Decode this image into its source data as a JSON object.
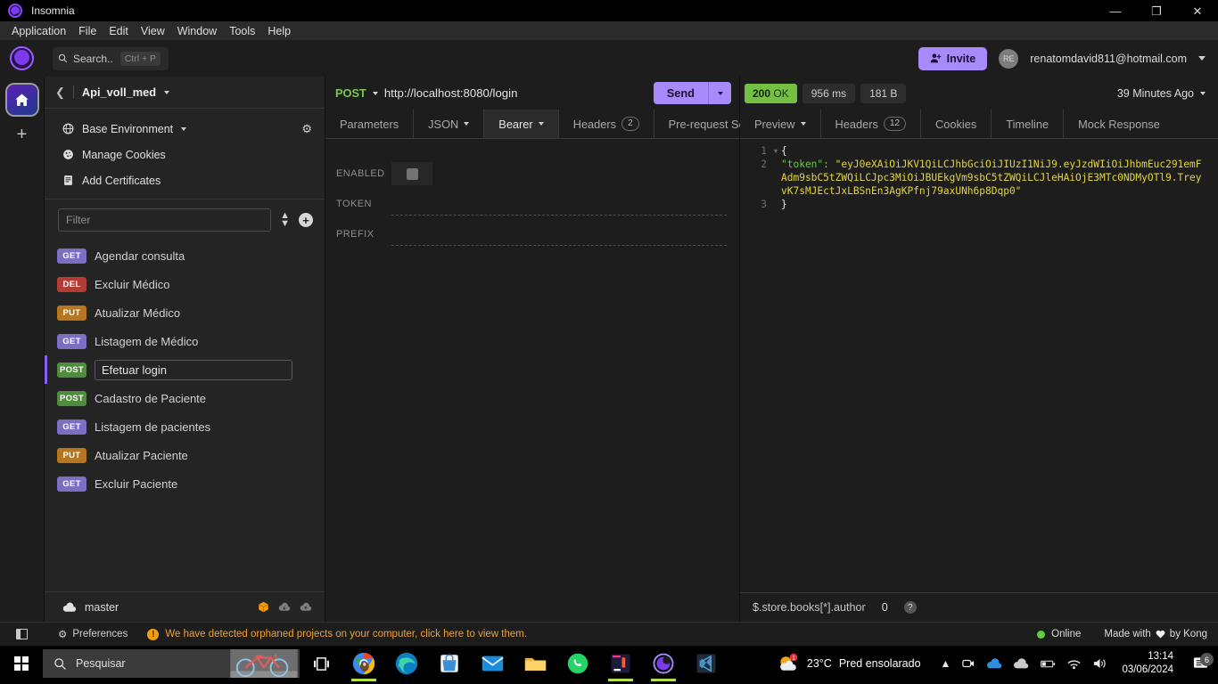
{
  "window": {
    "app_title": "Insomnia",
    "minimize": "—",
    "maximize": "❐",
    "close": "✕"
  },
  "menubar": {
    "items": [
      "Application",
      "File",
      "Edit",
      "View",
      "Window",
      "Tools",
      "Help"
    ]
  },
  "header": {
    "search_placeholder": "Search..",
    "search_shortcut": "Ctrl + P",
    "invite_label": "Invite",
    "avatar_initials": "RE",
    "account_email": "renatomdavid811@hotmail.com"
  },
  "sidebar": {
    "workspace": "Api_voll_med",
    "environment": {
      "label": "Base Environment",
      "cookies": "Manage Cookies",
      "certificates": "Add Certificates"
    },
    "filter_placeholder": "Filter",
    "requests": [
      {
        "method": "GET",
        "name": "Agendar consulta",
        "active": false
      },
      {
        "method": "DEL",
        "name": "Excluir Médico",
        "active": false
      },
      {
        "method": "PUT",
        "name": "Atualizar Médico",
        "active": false
      },
      {
        "method": "GET",
        "name": "Listagem de Médico",
        "active": false
      },
      {
        "method": "POST",
        "name": "Efetuar login",
        "active": true
      },
      {
        "method": "POST",
        "name": "Cadastro de Paciente",
        "active": false
      },
      {
        "method": "GET",
        "name": "Listagem de pacientes",
        "active": false
      },
      {
        "method": "PUT",
        "name": "Atualizar Paciente",
        "active": false
      },
      {
        "method": "GET",
        "name": "Excluir Paciente",
        "active": false
      }
    ],
    "branch": "master"
  },
  "request": {
    "method": "POST",
    "url": "http://localhost:8080/login",
    "send_label": "Send",
    "tabs": [
      {
        "label": "Parameters",
        "badge": "",
        "dropdown": false,
        "active": false
      },
      {
        "label": "JSON",
        "badge": "",
        "dropdown": true,
        "active": false
      },
      {
        "label": "Bearer",
        "badge": "",
        "dropdown": true,
        "active": true
      },
      {
        "label": "Headers",
        "badge": "2",
        "dropdown": false,
        "active": false
      },
      {
        "label": "Pre-request Sc",
        "badge": "",
        "dropdown": false,
        "active": false
      }
    ],
    "auth": {
      "enabled_label": "ENABLED",
      "token_label": "TOKEN",
      "prefix_label": "PREFIX",
      "token_value": "",
      "prefix_value": ""
    }
  },
  "response": {
    "status_code": "200",
    "status_text": "OK",
    "time": "956 ms",
    "size": "181 B",
    "timestamp": "39 Minutes Ago",
    "tabs": [
      {
        "label": "Preview",
        "badge": "",
        "dropdown": true,
        "active": true
      },
      {
        "label": "Headers",
        "badge": "12",
        "dropdown": false,
        "active": false
      },
      {
        "label": "Cookies",
        "badge": "",
        "dropdown": false,
        "active": false
      },
      {
        "label": "Timeline",
        "badge": "",
        "dropdown": false,
        "active": false
      },
      {
        "label": "Mock Response",
        "badge": "",
        "dropdown": false,
        "active": false
      }
    ],
    "body": {
      "line1_num": "1",
      "line1_text": "{",
      "line2_num": "2",
      "line2_key": "\"token\":",
      "line2_value": "\"eyJ0eXAiOiJKV1QiLCJhbGciOiJIUzI1NiJ9.eyJzdWIiOiJhbmEuc291emFAdm9sbC5tZWQiLCJpc3MiOiJBUEkgVm9sbC5tZWQiLCJleHAiOjE3MTc0NDMyOTl9.TreyvK7sMJEctJxLBSnEn3AgKPfnj79axUNh6p8Dqp0\"",
      "line3_num": "3",
      "line3_text": "}"
    },
    "filter_placeholder": "$.store.books[*].author",
    "filter_result": "0"
  },
  "statusbar": {
    "preferences": "Preferences",
    "warning": "We have detected orphaned projects on your computer, click here to view them.",
    "online": "Online",
    "made_with_prefix": "Made with",
    "made_with_suffix": "by Kong"
  },
  "taskbar": {
    "search_placeholder": "Pesquisar",
    "temperature": "23°C",
    "weather": "Pred ensolarado",
    "time": "13:14",
    "date": "03/06/2024",
    "notification_count": "6"
  },
  "colors": {
    "accent_purple": "#a78bfa",
    "method_get": "#7b6fc4",
    "method_post": "#4f8c3b",
    "method_put": "#b5761f",
    "method_del": "#b43d33",
    "status_ok": "#74c043",
    "warning": "#f0a132"
  }
}
